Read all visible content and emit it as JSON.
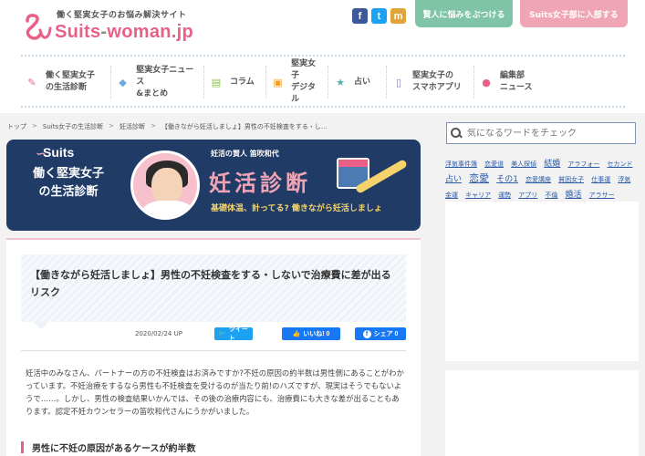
{
  "header": {
    "tagline": "働く堅実女子のお悩み解決サイト",
    "site_name_main": "Suits",
    "site_name_sep": "-",
    "site_name_rest": "woman.jp",
    "consult_button": "賢人に悩みをぶつける",
    "join_button": "Suits女子部に入部する",
    "social": [
      {
        "name": "facebook-icon",
        "glyph": "f"
      },
      {
        "name": "twitter-icon",
        "glyph": "t"
      },
      {
        "name": "mail-icon",
        "glyph": "m"
      }
    ]
  },
  "nav": [
    {
      "label": "働く堅実女子\nの生活診断",
      "icon": "clipboard-icon",
      "color": "#e95f87",
      "glyph": "✎"
    },
    {
      "label": "堅実女子ニュース\n&まとめ",
      "icon": "tag-icon",
      "color": "#6fa8dc",
      "glyph": "◆"
    },
    {
      "label": "コラム",
      "icon": "book-icon",
      "color": "#8bc34a",
      "glyph": "▤"
    },
    {
      "label": "堅実女子\nデジタル",
      "icon": "bag-icon",
      "color": "#f0a030",
      "glyph": "▣"
    },
    {
      "label": "占い",
      "icon": "star-icon",
      "color": "#4db6ac",
      "glyph": "★"
    },
    {
      "label": "堅実女子の\nスマホアプリ",
      "icon": "smartphone-icon",
      "color": "#9575cd",
      "glyph": "▯"
    },
    {
      "label": "編集部\nニュース",
      "icon": "chat-icon",
      "color": "#e95f87",
      "glyph": "●"
    }
  ],
  "breadcrumb": [
    "トップ",
    "Suits女子の生活診断",
    "妊活診断",
    "【働きながら妊活しましょ】男性の不妊検査をする・し..."
  ],
  "banner": {
    "brand": "Suits",
    "line1": "働く堅実女子",
    "line2": "の生活診断",
    "sub": "妊活の賢人 笛吹和代",
    "title": "妊活診断",
    "tagline": "基礎体温、計ってる? 働きながら妊活しましょ"
  },
  "article": {
    "title": "【働きながら妊活しましょ】男性の不妊検査をする・しないで治療費に差が出るリスク",
    "date": "2020/02/24 UP",
    "tweet": "ツイート",
    "like": "いいね! 0",
    "share": "シェア 0",
    "body": "妊活中のみなさん、パートナーの方の不妊検査はお済みですか?不妊の原因の約半数は男性側にあることがわかっています。不妊治療をするなら男性も不妊検査を受けるのが当たり前!のハズですが、現実はそうでもないようで……。しかし、男性の検査結果いかんでは、その後の治療内容にも、治療費にも大きな差が出ることもあります。認定不妊カウンセラーの笛吹和代さんにうかがいました。",
    "heading": "男性に不妊の原因があるケースが約半数"
  },
  "sidebar": {
    "search_placeholder": "気になるワードをチェック",
    "tags": [
      {
        "text": "浮気事件簿",
        "size": "s"
      },
      {
        "text": "恋愛道",
        "size": "s"
      },
      {
        "text": "美人探偵",
        "size": "s"
      },
      {
        "text": "結婚",
        "size": "m"
      },
      {
        "text": "アラフォー",
        "size": "s"
      },
      {
        "text": "セカンド",
        "size": "s"
      },
      {
        "text": "占い",
        "size": "m"
      },
      {
        "text": "恋愛",
        "size": "l"
      },
      {
        "text": "その1",
        "size": "m"
      },
      {
        "text": "恋愛講座",
        "size": "s"
      },
      {
        "text": "貧困女子",
        "size": "s"
      },
      {
        "text": "仕事運",
        "size": "s"
      },
      {
        "text": "浮気",
        "size": "s"
      },
      {
        "text": "金運",
        "size": "s"
      },
      {
        "text": "キャリア",
        "size": "s"
      },
      {
        "text": "運勢",
        "size": "s"
      },
      {
        "text": "アプリ",
        "size": "s"
      },
      {
        "text": "不倫",
        "size": "s"
      },
      {
        "text": "婚活",
        "size": "m"
      },
      {
        "text": "アラサー",
        "size": "s"
      }
    ]
  },
  "colors": {
    "brand_pink": "#e95f87",
    "navy": "#1f3b66",
    "link_blue": "#2a5aa8"
  }
}
